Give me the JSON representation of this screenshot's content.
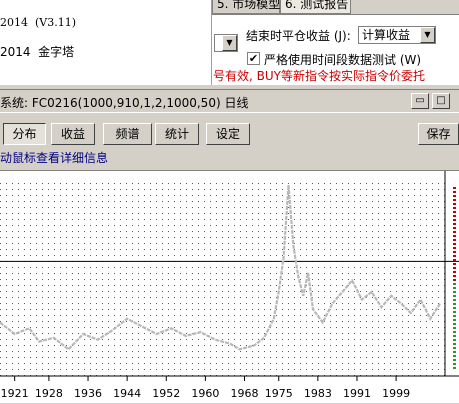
{
  "info_panel": {
    "version_line": "2014  (V3.11)",
    "strategy_line": "2014  金字塔"
  },
  "settings": {
    "tabs": [
      "5. 市场模型",
      "6. 测试报告"
    ],
    "end_close_label": "结束时平仓收益 (J):",
    "calc_select_value": "计算收益",
    "strict_label": "严格使用时间段数据测试 (W)",
    "strict_checked": "✔",
    "warning": "号有效, BUY等新指令按实际指令价委托"
  },
  "window": {
    "title": "系统: FC0216(1000,910,1,2,1000,50) 日线",
    "minimize_glyph": "▭",
    "maximize_glyph": "□"
  },
  "toolbar": {
    "distribution": "分布",
    "returns": "收益",
    "spectrum": "频谱",
    "stats": "统计",
    "settings": "设定",
    "save": "保存"
  },
  "hint": "动鼠标查看详细信息",
  "chart_data": {
    "type": "line",
    "x_ticks": [
      "1921",
      "1928",
      "1936",
      "1944",
      "1952",
      "1960",
      "1968",
      "1975",
      "1983",
      "1991",
      "1999"
    ],
    "xlim": [
      1918,
      2009
    ],
    "ylim": [
      0,
      100
    ],
    "grid": "dotted",
    "series": [
      {
        "color": "#b8b8b8",
        "x": [
          1918,
          1921,
          1924,
          1926,
          1929,
          1932,
          1935,
          1938,
          1941,
          1944,
          1947,
          1950,
          1953,
          1956,
          1959,
          1962,
          1965,
          1967,
          1970,
          1972,
          1974,
          1975,
          1976,
          1977,
          1978,
          1979,
          1980,
          1981,
          1982,
          1984,
          1986,
          1988,
          1990,
          1992,
          1994,
          1996,
          1998,
          2000,
          2002,
          2004,
          2006,
          2008
        ],
        "y": [
          28,
          22,
          25,
          18,
          20,
          14,
          22,
          19,
          24,
          30,
          26,
          22,
          25,
          21,
          23,
          19,
          17,
          14,
          16,
          20,
          30,
          44,
          62,
          100,
          68,
          52,
          42,
          54,
          35,
          28,
          38,
          44,
          50,
          40,
          44,
          36,
          42,
          38,
          33,
          40,
          30,
          38
        ]
      }
    ],
    "reference_line_y": 60
  },
  "colors": {
    "warning": "#cc0000",
    "hint": "#000080",
    "series": "#b8b8b8",
    "right_marks_top": "#cc0000",
    "right_marks_bottom": "#2a9a2a"
  }
}
